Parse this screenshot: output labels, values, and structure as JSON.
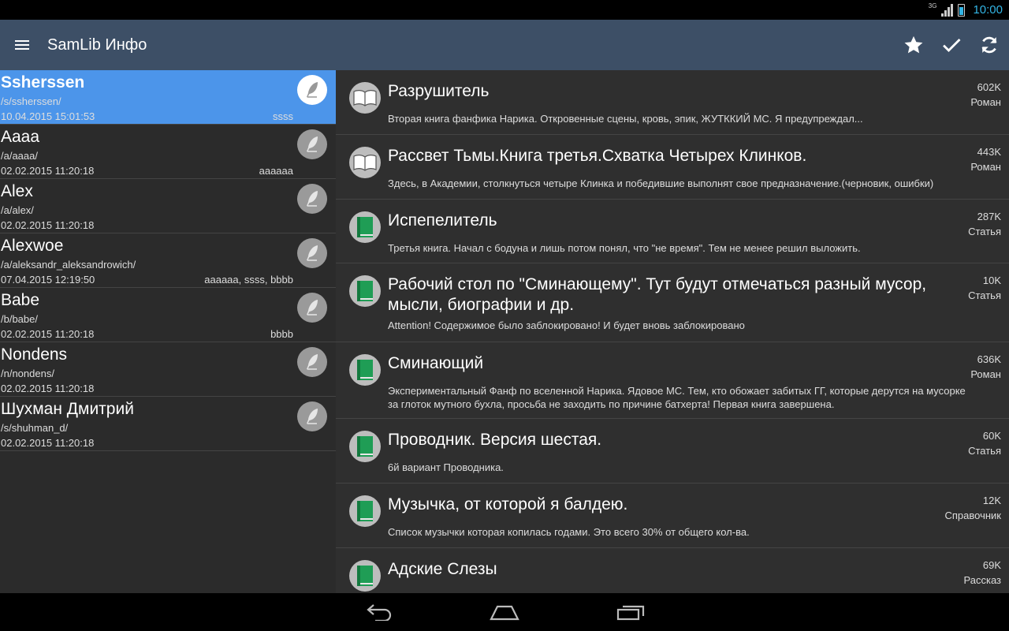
{
  "status_bar": {
    "network": "3G",
    "time": "10:00",
    "battery_color": "#33b5e5"
  },
  "app_bar": {
    "title": "SamLib Инфо",
    "background": "#3d4f66",
    "menu_icon": "hamburger-menu-icon",
    "actions": [
      {
        "name": "star-icon"
      },
      {
        "name": "check-icon"
      },
      {
        "name": "refresh-icon"
      }
    ]
  },
  "authors": [
    {
      "name": "Ssherssen",
      "path": "/s/ssherssen/",
      "date": "10.04.2015 15:01:53",
      "tags": "ssss",
      "selected": true
    },
    {
      "name": "Aaaa",
      "path": "/a/aaaa/",
      "date": "02.02.2015 11:20:18",
      "tags": "aaaaaa"
    },
    {
      "name": "Alex",
      "path": "/a/alex/",
      "date": "02.02.2015 11:20:18",
      "tags": ""
    },
    {
      "name": "Alexwoe",
      "path": "/a/aleksandr_aleksandrowich/",
      "date": "07.04.2015 12:19:50",
      "tags": "aaaaaa, ssss, bbbb"
    },
    {
      "name": "Babe",
      "path": "/b/babe/",
      "date": "02.02.2015 11:20:18",
      "tags": "bbbb"
    },
    {
      "name": "Nondens",
      "path": "/n/nondens/",
      "date": "02.02.2015 11:20:18",
      "tags": ""
    },
    {
      "name": "Шухман Дмитрий",
      "path": "/s/shuhman_d/",
      "date": "02.02.2015 11:20:18",
      "tags": ""
    }
  ],
  "books": [
    {
      "title": "Разрушитель",
      "desc": "Вторая книга фанфика Нарика. Откровенные сцены, кровь, эпик, ЖУТККИЙ МС. Я предупреждал...",
      "size": "602K",
      "type": "Роман",
      "icon": "open-book-icon"
    },
    {
      "title": "Рассвет Тьмы.Книга третья.Схватка Четырех Клинков.",
      "desc": "Здесь, в Академии, столкнуться четыре Клинка и победившие выполнят свое предназначение.(черновик, ошибки)",
      "size": "443K",
      "type": "Роман",
      "icon": "open-book-icon"
    },
    {
      "title": "Испепелитель",
      "desc": "Третья книга. Начал с бодуна и лишь потом понял, что \"не время\". Тем не менее решил выложить.",
      "size": "287K",
      "type": "Статья",
      "icon": "green-book-icon"
    },
    {
      "title": "Рабочий стол по \"Сминающему\". Тут будут отмечаться разный мусор, мысли, биографии и др.",
      "desc": "Attention! Содержимое было заблокировано! И будет вновь заблокировано",
      "size": "10K",
      "type": "Статья",
      "icon": "green-book-icon"
    },
    {
      "title": "Сминающий",
      "desc": "Экспериментальный Фанф по вселенной Нарика. Ядовое МС. Тем, кто обожает забитых ГГ, которые дерутся на мусорке за глоток мутного бухла, просьба не заходить по причине батхерта! Первая книга завершена.",
      "size": "636K",
      "type": "Роман",
      "icon": "green-book-icon"
    },
    {
      "title": "Проводник. Версия шестая.",
      "desc": "6й вариант Проводника.",
      "size": "60K",
      "type": "Статья",
      "icon": "green-book-icon"
    },
    {
      "title": "Музычка, от которой я балдею.",
      "desc": "Список музычки которая копилась годами. Это всего 30% от общего кол-ва.",
      "size": "12K",
      "type": "Справочник",
      "icon": "green-book-icon"
    },
    {
      "title": "Адские Слезы",
      "desc": "",
      "size": "69K",
      "type": "Рассказ",
      "icon": "green-book-icon"
    }
  ],
  "nav_bar": [
    {
      "name": "back-icon"
    },
    {
      "name": "home-icon"
    },
    {
      "name": "recent-apps-icon"
    }
  ]
}
